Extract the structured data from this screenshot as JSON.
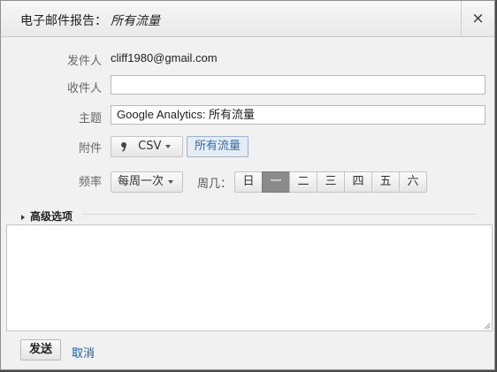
{
  "dialog": {
    "title_prefix": "电子邮件报告：",
    "title_name": "所有流量",
    "close_glyph": "×"
  },
  "form": {
    "from_label": "发件人",
    "from_value": "cliff1980@gmail.com",
    "to_label": "收件人",
    "to_value": "",
    "subject_label": "主题",
    "subject_value": "Google Analytics: 所有流量",
    "attachment_label": "附件",
    "attachment_format": "CSV",
    "attachment_chip": "所有流量",
    "frequency_label": "频率",
    "frequency_value": "每周一次",
    "weekday_label": "周几：",
    "weekdays": [
      "日",
      "一",
      "二",
      "三",
      "四",
      "五",
      "六"
    ],
    "selected_weekday": "一",
    "advanced_label": "高级选项"
  },
  "footer": {
    "send_label": "发送",
    "cancel_label": "取消"
  },
  "colors": {
    "accent_link": "#1a5fa8",
    "chip_background": "#e4ecf6",
    "active_day": "#8a8a8a"
  },
  "icons": {
    "attachment_format_icon": "csv-icon",
    "dropdown_icon": "chevron-down-icon",
    "disclosure_icon": "triangle-right-icon",
    "resize_icon": "resize-grip-icon"
  }
}
